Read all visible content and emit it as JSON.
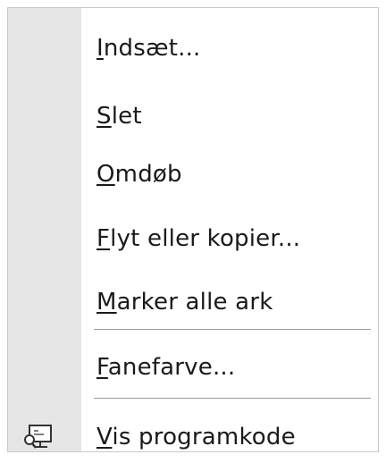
{
  "menu": {
    "items": [
      {
        "label": "Indsæt...",
        "mnemonic": "I"
      },
      {
        "label": "Slet",
        "mnemonic": "S"
      },
      {
        "label": "Omdøb",
        "mnemonic": "O"
      },
      {
        "label": "Flyt eller kopier...",
        "mnemonic": "F"
      },
      {
        "label": "Marker alle ark",
        "mnemonic": "M"
      },
      {
        "label": "Fanefarve...",
        "mnemonic": "F"
      },
      {
        "label": "Vis programkode",
        "mnemonic": "V",
        "icon": "view-code-icon"
      }
    ]
  },
  "colors": {
    "background": "#ffffff",
    "icon_strip": "#e6e6e6",
    "text": "#1a1a1a",
    "separator": "#9a9a9a"
  }
}
